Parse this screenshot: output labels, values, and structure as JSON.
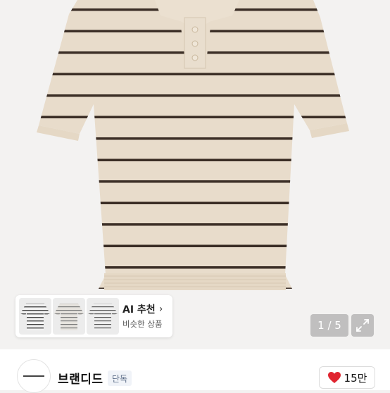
{
  "product": {
    "image_name": "striped polo knit shirt",
    "colors": {
      "base": "#e8dccb",
      "stripe": "#3b2e26",
      "background": "#f3f2f1"
    }
  },
  "ai_recommend": {
    "title": "AI 추천",
    "chevron_icon": "chevron-right-icon",
    "subtitle": "비슷한 상품",
    "thumbnails": [
      "similar-product-1",
      "similar-product-2",
      "similar-product-3"
    ]
  },
  "gallery": {
    "counter": "1 / 5",
    "expand_icon": "expand-icon"
  },
  "brand": {
    "name": "브랜디드",
    "badge": "단독"
  },
  "like": {
    "icon": "heart-icon",
    "count": "15만",
    "heart_color": "#e0242f"
  }
}
